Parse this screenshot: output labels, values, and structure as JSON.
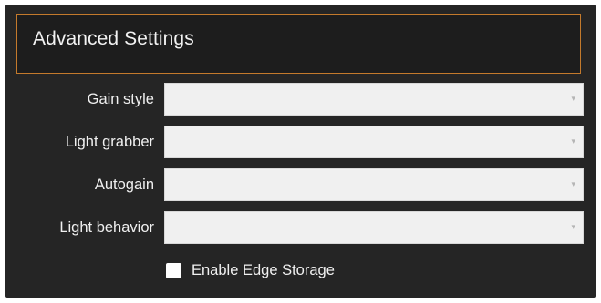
{
  "header": {
    "title": "Advanced Settings"
  },
  "fields": [
    {
      "label": "Gain style",
      "value": ""
    },
    {
      "label": "Light grabber",
      "value": ""
    },
    {
      "label": "Autogain",
      "value": ""
    },
    {
      "label": "Light behavior",
      "value": ""
    }
  ],
  "dropdown_arrow": "▾",
  "checkbox": {
    "label": "Enable Edge Storage",
    "checked": false
  },
  "colors": {
    "panel_background": "#252525",
    "header_border": "#c47a2c",
    "text": "#f0f0f0",
    "select_background": "#f0f0f0"
  }
}
